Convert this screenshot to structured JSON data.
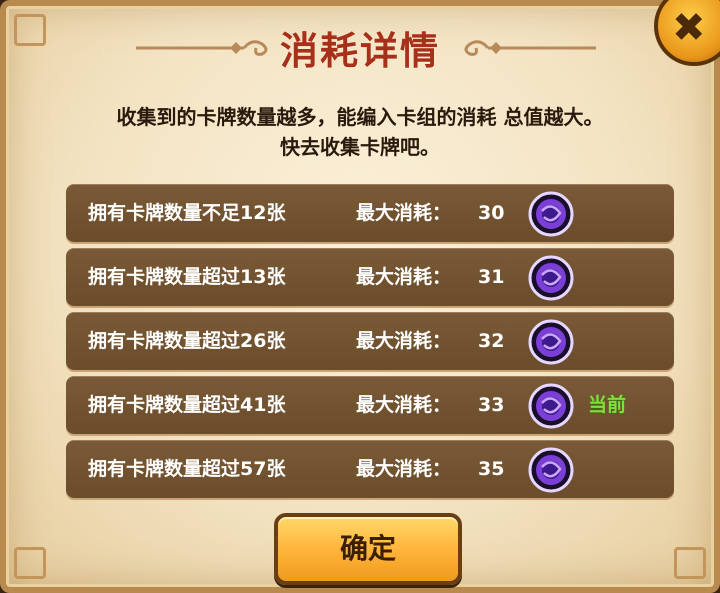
{
  "dialog": {
    "title": "消耗详情",
    "description_line1": "收集到的卡牌数量越多，能编入卡组的消耗 总值越大。",
    "description_line2": "快去收集卡牌吧。",
    "rows": [
      {
        "condition": "拥有卡牌数量不足12张",
        "label": "最大消耗：",
        "value": "30",
        "current": ""
      },
      {
        "condition": "拥有卡牌数量超过13张",
        "label": "最大消耗：",
        "value": "31",
        "current": ""
      },
      {
        "condition": "拥有卡牌数量超过26张",
        "label": "最大消耗：",
        "value": "32",
        "current": ""
      },
      {
        "condition": "拥有卡牌数量超过41张",
        "label": "最大消耗：",
        "value": "33",
        "current": "当前"
      },
      {
        "condition": "拥有卡牌数量超过57张",
        "label": "最大消耗：",
        "value": "35",
        "current": ""
      }
    ],
    "confirm_label": "确定",
    "close_icon": "close-x-icon"
  },
  "colors": {
    "title": "#a8301a",
    "row_bg": "#6b4c2b",
    "current_tag": "#7fe03a",
    "button": "#ffb53c"
  }
}
